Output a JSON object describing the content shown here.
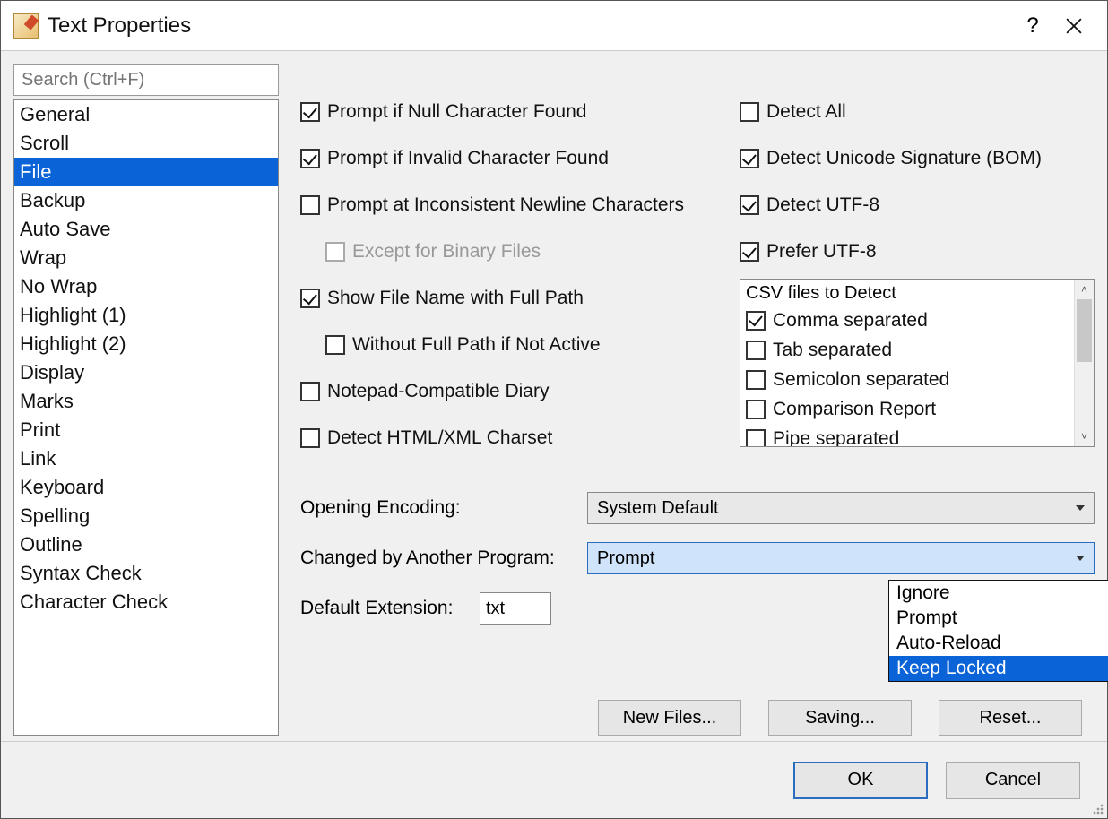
{
  "window": {
    "title": "Text Properties"
  },
  "search": {
    "placeholder": "Search (Ctrl+F)"
  },
  "categories": [
    {
      "label": "General",
      "selected": false
    },
    {
      "label": "Scroll",
      "selected": false
    },
    {
      "label": "File",
      "selected": true
    },
    {
      "label": "Backup",
      "selected": false
    },
    {
      "label": "Auto Save",
      "selected": false
    },
    {
      "label": "Wrap",
      "selected": false
    },
    {
      "label": "No Wrap",
      "selected": false
    },
    {
      "label": "Highlight (1)",
      "selected": false
    },
    {
      "label": "Highlight (2)",
      "selected": false
    },
    {
      "label": "Display",
      "selected": false
    },
    {
      "label": "Marks",
      "selected": false
    },
    {
      "label": "Print",
      "selected": false
    },
    {
      "label": "Link",
      "selected": false
    },
    {
      "label": "Keyboard",
      "selected": false
    },
    {
      "label": "Spelling",
      "selected": false
    },
    {
      "label": "Outline",
      "selected": false
    },
    {
      "label": "Syntax Check",
      "selected": false
    },
    {
      "label": "Character Check",
      "selected": false
    }
  ],
  "leftOptions": [
    {
      "label": "Prompt if Null Character Found",
      "checked": true,
      "indent": 0,
      "disabled": false
    },
    {
      "label": "Prompt if Invalid Character Found",
      "checked": true,
      "indent": 0,
      "disabled": false
    },
    {
      "label": "Prompt at Inconsistent Newline Characters",
      "checked": false,
      "indent": 0,
      "disabled": false
    },
    {
      "label": "Except for Binary Files",
      "checked": false,
      "indent": 1,
      "disabled": true
    },
    {
      "label": "Show File Name with Full Path",
      "checked": true,
      "indent": 0,
      "disabled": false
    },
    {
      "label": "Without Full Path if Not Active",
      "checked": false,
      "indent": 1,
      "disabled": false
    },
    {
      "label": "Notepad-Compatible Diary",
      "checked": false,
      "indent": 0,
      "disabled": false
    },
    {
      "label": "Detect HTML/XML Charset",
      "checked": false,
      "indent": 0,
      "disabled": false
    }
  ],
  "rightOptions": [
    {
      "label": "Detect All",
      "checked": false
    },
    {
      "label": "Detect Unicode Signature (BOM)",
      "checked": true
    },
    {
      "label": "Detect UTF-8",
      "checked": true
    },
    {
      "label": "Prefer UTF-8",
      "checked": true
    }
  ],
  "csv": {
    "header": "CSV files to Detect",
    "items": [
      {
        "label": "Comma separated",
        "checked": true
      },
      {
        "label": "Tab separated",
        "checked": false
      },
      {
        "label": "Semicolon separated",
        "checked": false
      },
      {
        "label": "Comparison Report",
        "checked": false
      },
      {
        "label": "Pipe separated",
        "checked": false
      }
    ]
  },
  "form": {
    "openingEncoding": {
      "label": "Opening Encoding:",
      "value": "System Default"
    },
    "changedBy": {
      "label": "Changed by Another Program:",
      "value": "Prompt",
      "options": [
        "Ignore",
        "Prompt",
        "Auto-Reload",
        "Keep Locked"
      ],
      "highlighted": "Keep Locked"
    },
    "defaultExt": {
      "label": "Default Extension:",
      "value": "txt"
    }
  },
  "buttons": {
    "newFiles": "New Files...",
    "saving": "Saving...",
    "reset": "Reset...",
    "ok": "OK",
    "cancel": "Cancel"
  }
}
